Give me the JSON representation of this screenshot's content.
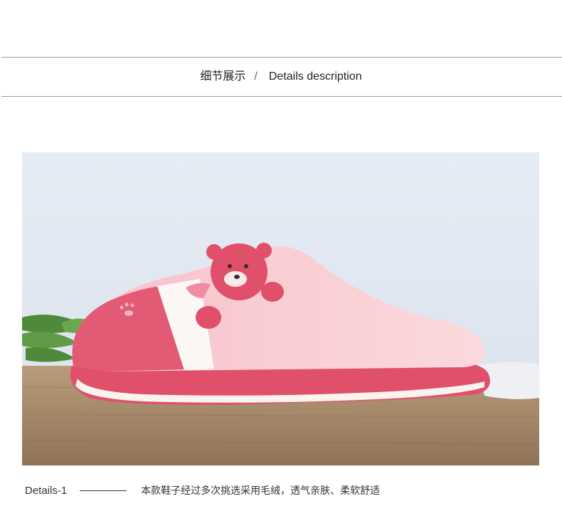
{
  "section": {
    "title_cn": "细节展示",
    "separator": "/",
    "title_en": "Details description"
  },
  "photo": {
    "subject": "pink plush slipper with bear embroidery",
    "colors": {
      "accent": "#e0506a",
      "light_pink": "#f9cfd4",
      "background": "#dfe7f1",
      "wood": "#a68a6a"
    }
  },
  "caption": {
    "label": "Details-1",
    "text": "本款鞋子经过多次挑选采用毛绒，透气亲肤、柔软舒适"
  }
}
